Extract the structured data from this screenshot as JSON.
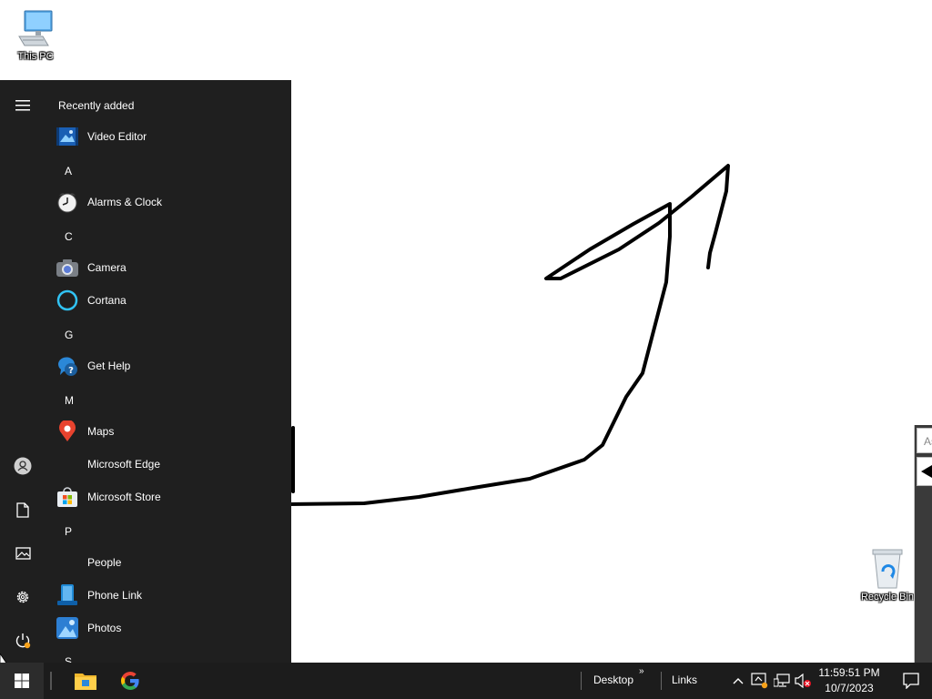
{
  "desktop": {
    "icons": [
      {
        "label": "This PC"
      },
      {
        "label": "Recycle Bin"
      }
    ]
  },
  "side_window": {
    "address_partial": "As"
  },
  "start_menu": {
    "section_title": "Recently added",
    "recent": [
      {
        "label": "Video Editor",
        "icon": "video-editor-icon"
      }
    ],
    "groups": [
      {
        "letter": "A",
        "apps": [
          {
            "label": "Alarms & Clock",
            "icon": "alarm-clock-icon"
          }
        ]
      },
      {
        "letter": "C",
        "apps": [
          {
            "label": "Camera",
            "icon": "camera-icon"
          },
          {
            "label": "Cortana",
            "icon": "cortana-icon"
          }
        ]
      },
      {
        "letter": "G",
        "apps": [
          {
            "label": "Get Help",
            "icon": "get-help-icon"
          }
        ]
      },
      {
        "letter": "M",
        "apps": [
          {
            "label": "Maps",
            "icon": "maps-icon"
          },
          {
            "label": "Microsoft Edge",
            "icon": ""
          },
          {
            "label": "Microsoft Store",
            "icon": "store-icon"
          }
        ]
      },
      {
        "letter": "P",
        "apps": [
          {
            "label": "People",
            "icon": ""
          },
          {
            "label": "Phone Link",
            "icon": "phone-link-icon"
          },
          {
            "label": "Photos",
            "icon": "photos-icon"
          }
        ]
      },
      {
        "letter": "S",
        "apps": []
      }
    ],
    "rail": [
      "hamburger-menu-icon",
      "user-account-icon",
      "documents-icon",
      "pictures-icon",
      "settings-gear-icon",
      "power-icon"
    ]
  },
  "taskbar": {
    "pinned": [
      "file-explorer-icon",
      "google-chrome-icon"
    ],
    "toolbars": {
      "desktop": "Desktop",
      "links": "Links"
    },
    "clock": {
      "time": "11:59:51 PM",
      "date": "10/7/2023"
    },
    "tray": [
      "chevron-up-icon",
      "security-icon",
      "network-icon",
      "volume-muted-icon"
    ]
  },
  "colors": {
    "start_bg": "#1f1f1f",
    "taskbar_bg": "#1c1c1c",
    "accent": "#0078d4"
  }
}
